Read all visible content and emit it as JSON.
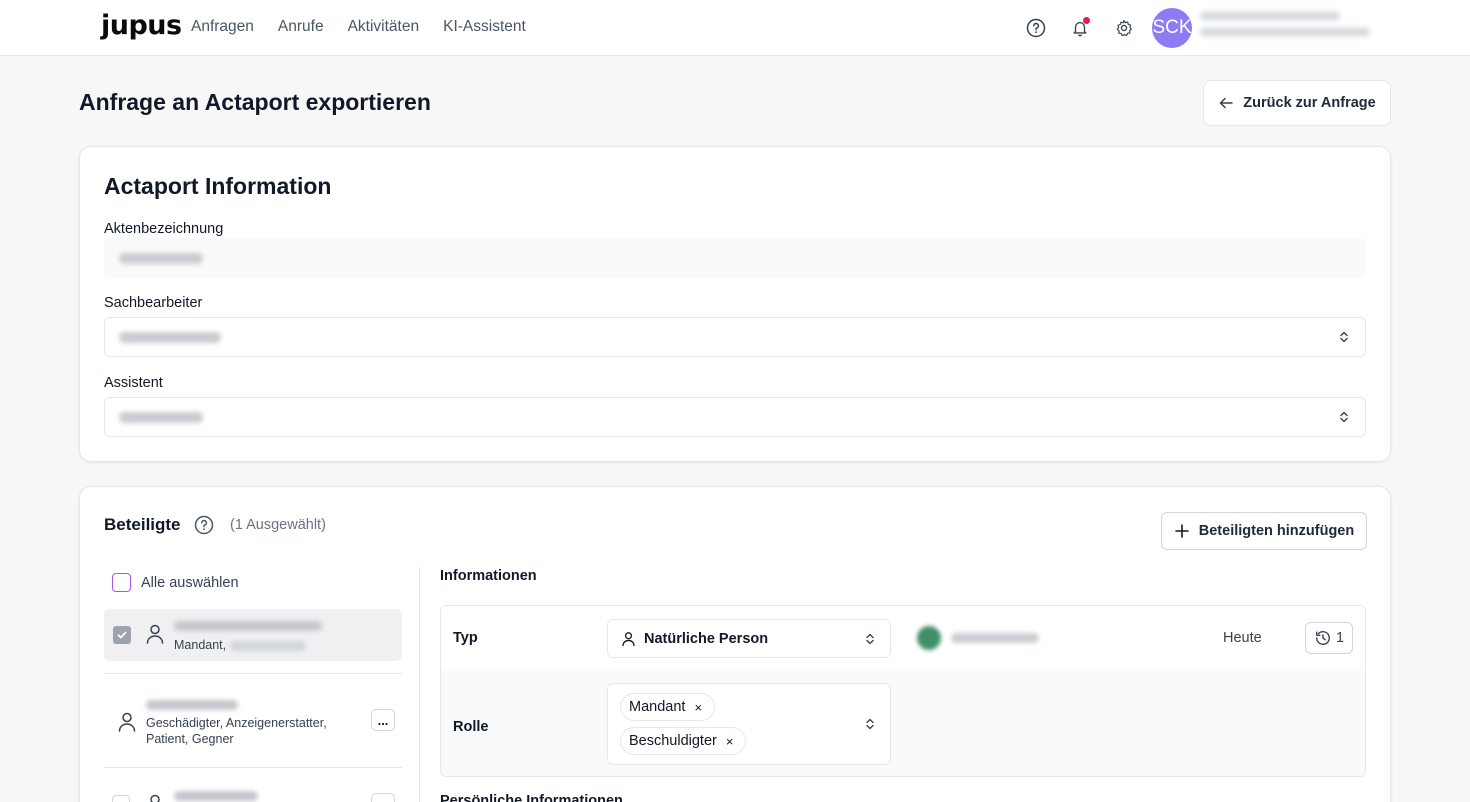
{
  "brand": {
    "logo": "jupus"
  },
  "nav": [
    "Anfragen",
    "Anrufe",
    "Aktivitäten",
    "KI-Assistent"
  ],
  "user": {
    "initials": "SCK"
  },
  "page": {
    "title": "Anfrage an Actaport exportieren",
    "back_label": "Zurück zur Anfrage"
  },
  "actaport": {
    "title": "Actaport Information",
    "fields": [
      {
        "label": "Aktenbezeichnung"
      },
      {
        "label": "Sachbearbeiter"
      },
      {
        "label": "Assistent"
      }
    ]
  },
  "beteiligte": {
    "title": "Beteiligte",
    "selected_count": "(1 Ausgewählt)",
    "add_label": "Beteiligten hinzufügen",
    "select_all": "Alle auswählen",
    "items": [
      {
        "roles": "Mandant,",
        "selected": true
      },
      {
        "roles": "Geschädigter, Anzeigenerstatter, Patient, Gegner",
        "selected": false
      },
      {
        "roles": "",
        "selected": false
      }
    ],
    "more_label": "..."
  },
  "informationen": {
    "title": "Informationen",
    "typ_label": "Typ",
    "typ_value": "Natürliche Person",
    "date_label": "Heute",
    "history_count": "1",
    "rolle_label": "Rolle",
    "roles": [
      "Mandant",
      "Beschuldigter"
    ],
    "remove_symbol": "×",
    "personal_title": "Persönliche Informationen"
  },
  "colors": {
    "accent_purple": "#a855f7",
    "avatar": "#8b7cf6",
    "notification": "#e11d48"
  }
}
